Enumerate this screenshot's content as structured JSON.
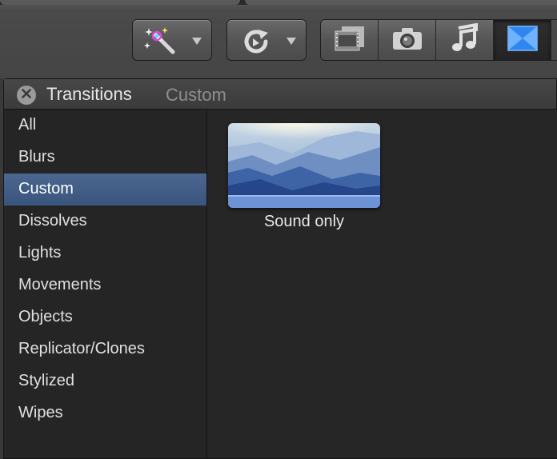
{
  "toolbar": {
    "buttons": [
      {
        "name": "effects-magic-wand",
        "icon": "magic-wand-icon",
        "has_menu": true
      },
      {
        "name": "retime",
        "icon": "retime-icon",
        "has_menu": true
      }
    ],
    "browser_segments": [
      {
        "name": "video-effects",
        "icon": "film-icon",
        "active": false
      },
      {
        "name": "photos",
        "icon": "camera-icon",
        "active": false
      },
      {
        "name": "music-and-sound",
        "icon": "music-note-icon",
        "active": false
      },
      {
        "name": "transitions",
        "icon": "transitions-icon",
        "active": true
      }
    ]
  },
  "panel": {
    "title": "Transitions",
    "subtitle": "Custom"
  },
  "sidebar": {
    "items": [
      {
        "label": "All"
      },
      {
        "label": "Blurs"
      },
      {
        "label": "Custom",
        "selected": true
      },
      {
        "label": "Dissolves"
      },
      {
        "label": "Lights"
      },
      {
        "label": "Movements"
      },
      {
        "label": "Objects"
      },
      {
        "label": "Replicator/Clones"
      },
      {
        "label": "Stylized"
      },
      {
        "label": "Wipes"
      }
    ]
  },
  "content": {
    "items": [
      {
        "label": "Sound only",
        "thumbnail": "blue-mountains-landscape"
      }
    ]
  },
  "colors": {
    "selection": "#3f5b84",
    "active_icon": "#3b8ff0"
  }
}
